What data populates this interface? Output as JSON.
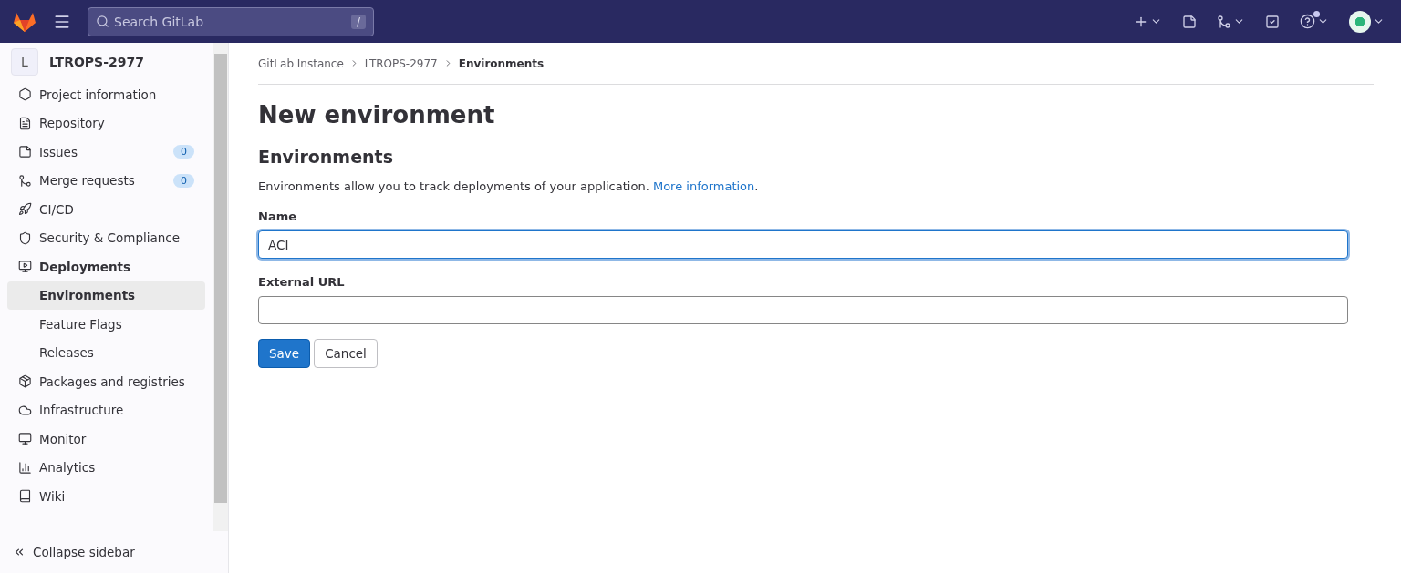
{
  "header": {
    "search_placeholder": "Search GitLab",
    "search_shortcut": "/",
    "help_notification": true
  },
  "sidebar": {
    "project_initial": "L",
    "project_name": "LTROPS-2977",
    "items": [
      {
        "label": "Project information",
        "selected": false
      },
      {
        "label": "Repository",
        "selected": false
      },
      {
        "label": "Issues",
        "badge": "0",
        "selected": false
      },
      {
        "label": "Merge requests",
        "badge": "0",
        "selected": false
      },
      {
        "label": "CI/CD",
        "selected": false
      },
      {
        "label": "Security & Compliance",
        "selected": false
      },
      {
        "label": "Deployments",
        "selected": true,
        "expanded": true,
        "children": [
          {
            "label": "Environments",
            "selected": true
          },
          {
            "label": "Feature Flags",
            "selected": false
          },
          {
            "label": "Releases",
            "selected": false
          }
        ]
      },
      {
        "label": "Packages and registries",
        "selected": false
      },
      {
        "label": "Infrastructure",
        "selected": false
      },
      {
        "label": "Monitor",
        "selected": false
      },
      {
        "label": "Analytics",
        "selected": false
      },
      {
        "label": "Wiki",
        "selected": false
      }
    ],
    "collapse_label": "Collapse sidebar"
  },
  "breadcrumbs": [
    "GitLab Instance",
    "LTROPS-2977",
    "Environments"
  ],
  "page_title": "New environment",
  "section_title": "Environments",
  "description": "Environments allow you to track deployments of your application.",
  "description_link": "More information",
  "description_end": ".",
  "fields": [
    {
      "label": "Name",
      "value": "ACI",
      "focused": true
    },
    {
      "label": "External URL",
      "focused": false
    }
  ],
  "buttons": [
    {
      "label": "Save",
      "kind": "primary"
    },
    {
      "label": "Cancel",
      "kind": "default"
    }
  ]
}
